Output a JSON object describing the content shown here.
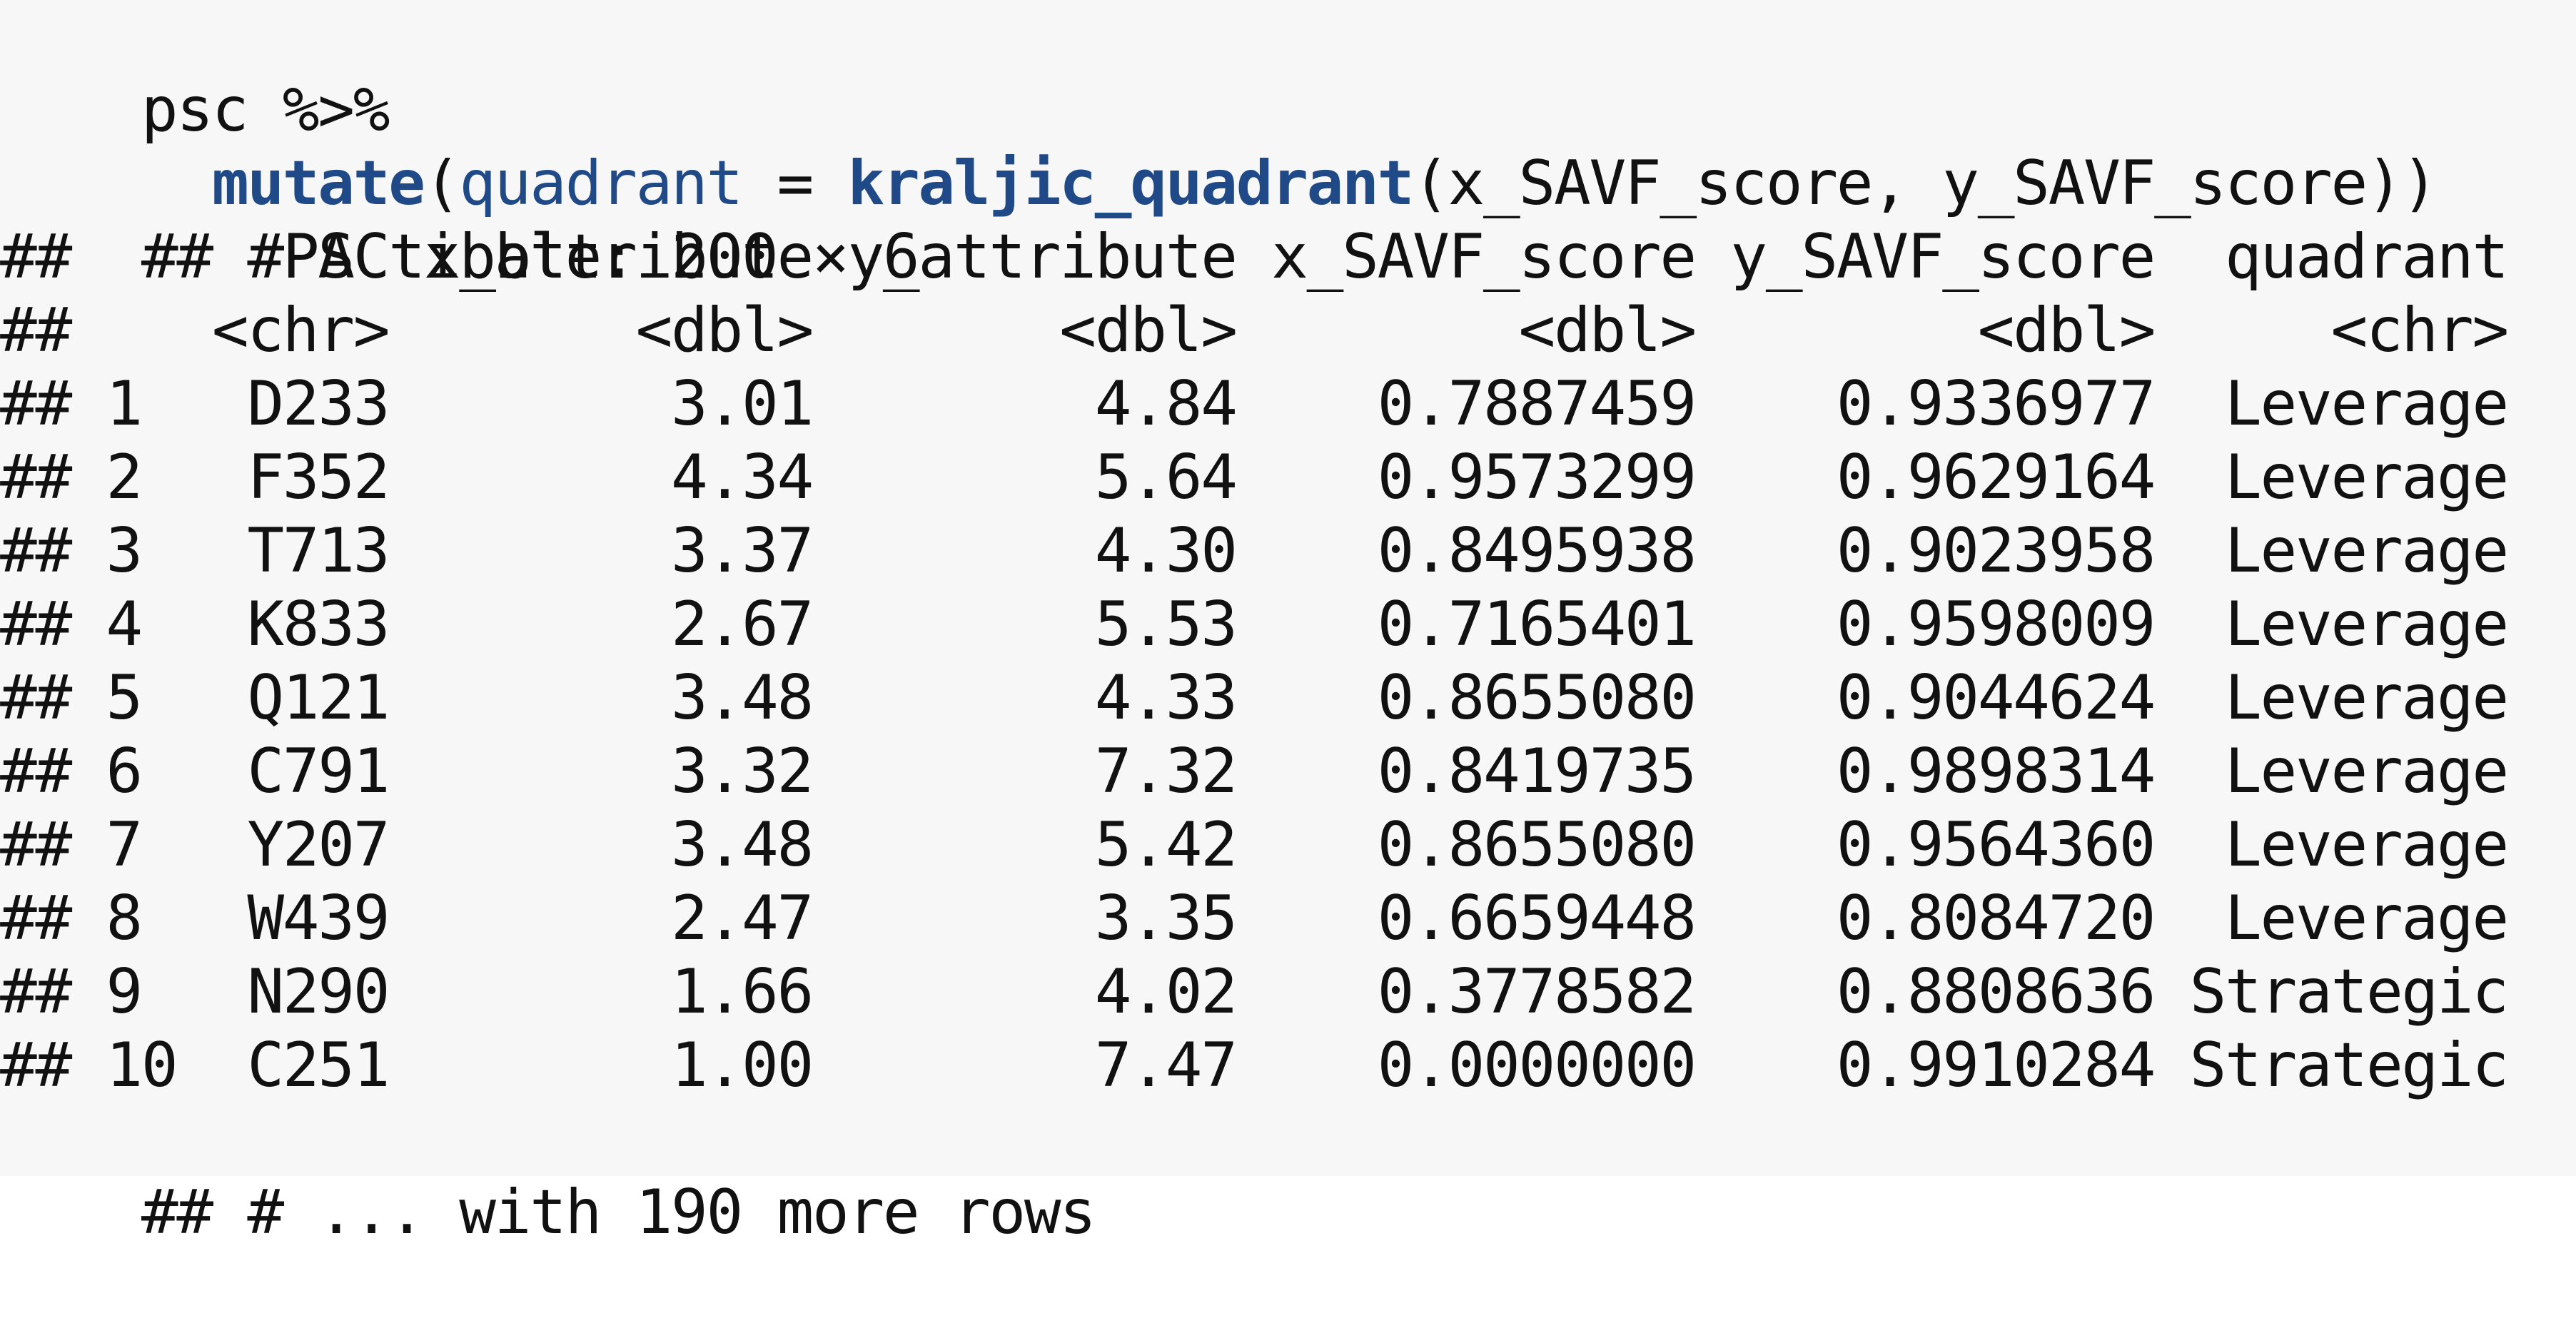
{
  "code": {
    "line1": "psc %>%",
    "line2": {
      "indent": "  ",
      "fn_mutate": "mutate",
      "open1": "(",
      "arg_quadrant": "quadrant",
      "eq": " = ",
      "fn_kraljic": "kraljic_quadrant",
      "rest": "(x_SAVF_score, y_SAVF_score))"
    }
  },
  "output": {
    "prefix": "##",
    "tibble_header": " # A tibble: 200 × 6",
    "columns": [
      "PSC",
      "x_attribute",
      "y_attribute",
      "x_SAVF_score",
      "y_SAVF_score",
      "quadrant"
    ],
    "types": [
      "<chr>",
      "<dbl>",
      "<dbl>",
      "<dbl>",
      "<dbl>",
      "<chr>"
    ],
    "rows": [
      [
        "1",
        "D233",
        "3.01",
        "4.84",
        "0.7887459",
        "0.9336977",
        "Leverage"
      ],
      [
        "2",
        "F352",
        "4.34",
        "5.64",
        "0.9573299",
        "0.9629164",
        "Leverage"
      ],
      [
        "3",
        "T713",
        "3.37",
        "4.30",
        "0.8495938",
        "0.9023958",
        "Leverage"
      ],
      [
        "4",
        "K833",
        "2.67",
        "5.53",
        "0.7165401",
        "0.9598009",
        "Leverage"
      ],
      [
        "5",
        "Q121",
        "3.48",
        "4.33",
        "0.8655080",
        "0.9044624",
        "Leverage"
      ],
      [
        "6",
        "C791",
        "3.32",
        "7.32",
        "0.8419735",
        "0.9898314",
        "Leverage"
      ],
      [
        "7",
        "Y207",
        "3.48",
        "5.42",
        "0.8655080",
        "0.9564360",
        "Leverage"
      ],
      [
        "8",
        "W439",
        "2.47",
        "3.35",
        "0.6659448",
        "0.8084720",
        "Leverage"
      ],
      [
        "9",
        "N290",
        "1.66",
        "4.02",
        "0.3778582",
        "0.8808636",
        "Strategic"
      ],
      [
        "10",
        "C251",
        "1.00",
        "7.47",
        "0.0000000",
        "0.9910284",
        "Strategic"
      ]
    ],
    "footer": " # ... with 190 more rows"
  },
  "colors": {
    "panel_background": "#f7f7f7",
    "function_color": "#204a87",
    "text_color": "#111111"
  }
}
